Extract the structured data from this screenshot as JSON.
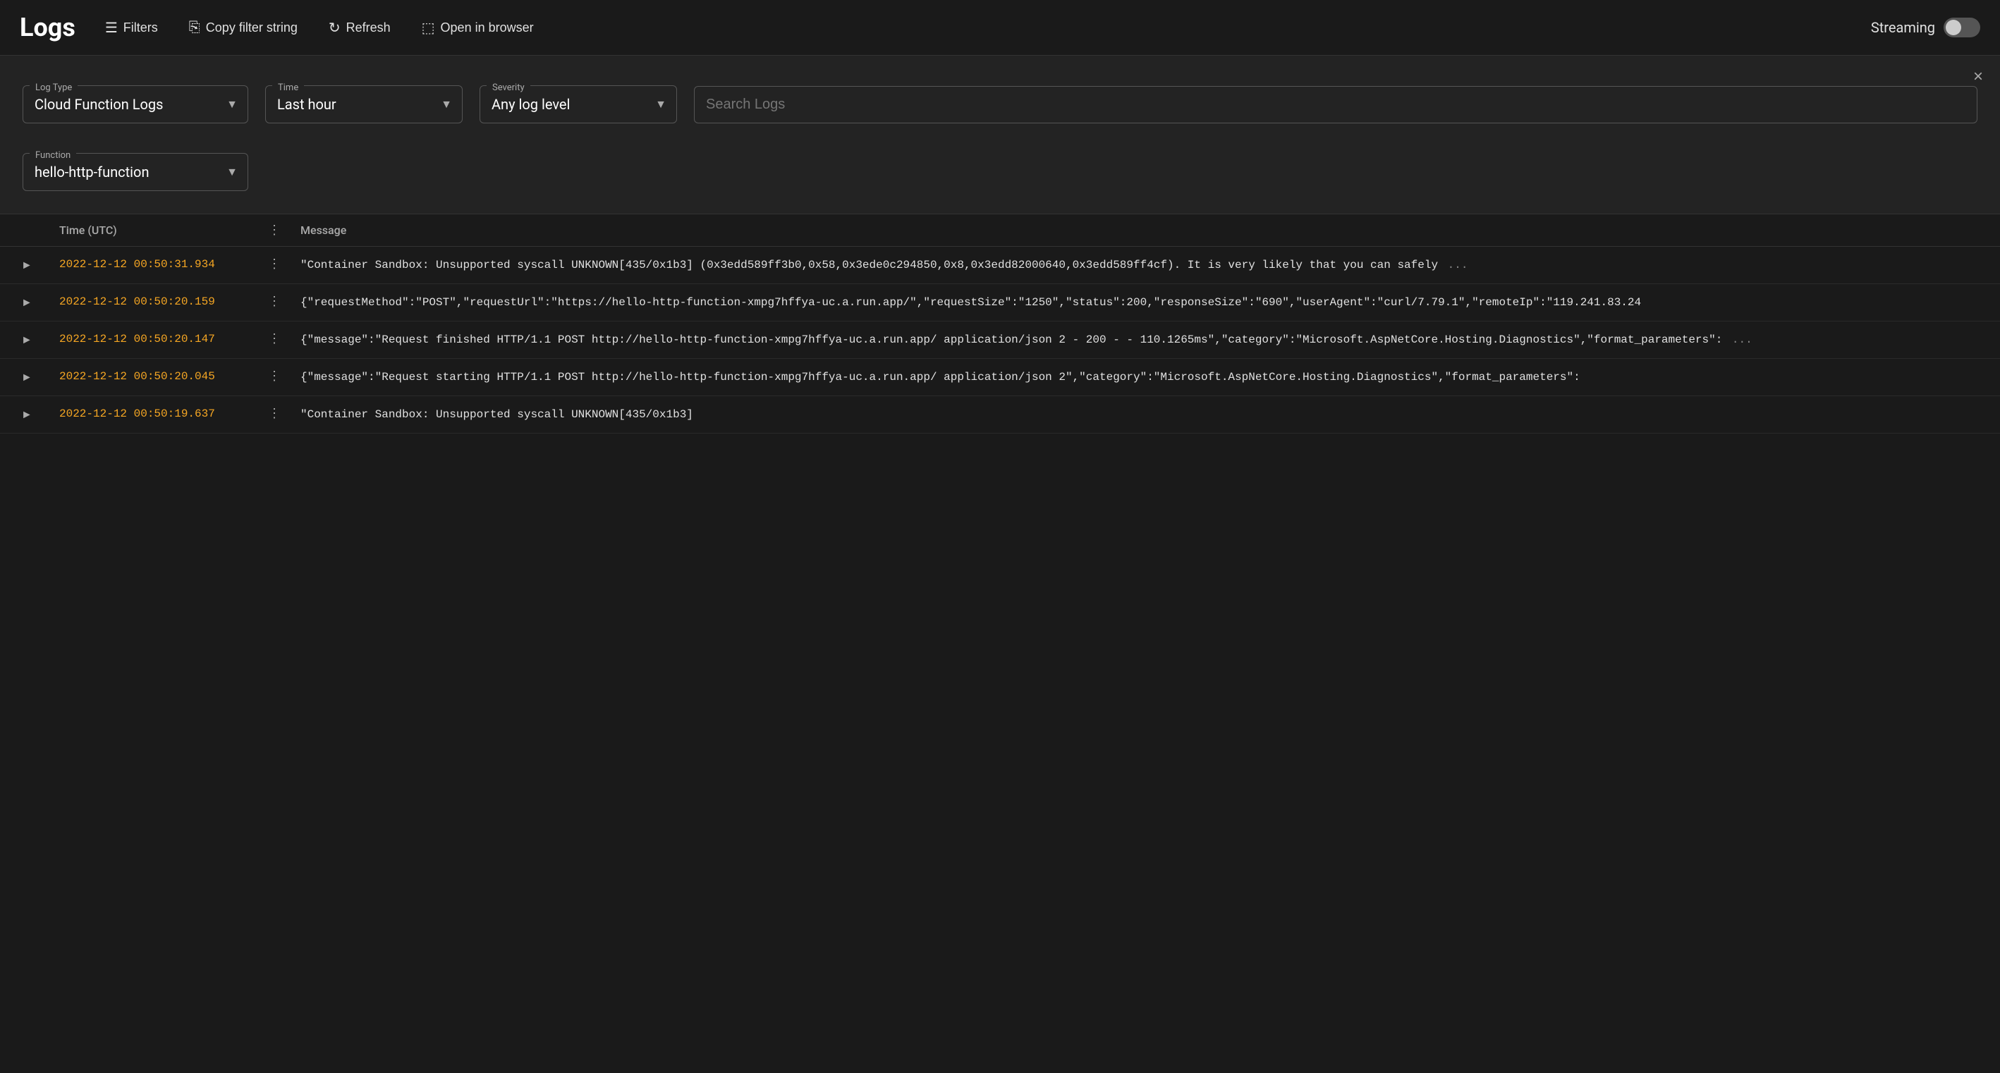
{
  "header": {
    "title": "Logs",
    "filters_label": "Filters",
    "copy_filter_label": "Copy filter string",
    "refresh_label": "Refresh",
    "open_browser_label": "Open in browser",
    "streaming_label": "Streaming",
    "streaming_enabled": false
  },
  "filters": {
    "close_label": "×",
    "log_type": {
      "label": "Log Type",
      "value": "Cloud Function Logs"
    },
    "time": {
      "label": "Time",
      "value": "Last hour"
    },
    "severity": {
      "label": "Severity",
      "value": "Any log level"
    },
    "search": {
      "placeholder": "Search Logs"
    },
    "function": {
      "label": "Function",
      "value": "hello-http-function"
    }
  },
  "table": {
    "columns": {
      "expand": "",
      "time": "Time (UTC)",
      "message": "Message"
    },
    "rows": [
      {
        "time": "2022-12-12 00:50:31.934",
        "message": "\"Container Sandbox: Unsupported syscall UNKNOWN[435/0x1b3] (0x3edd589ff3b0,0x58,0x3ede0c294850,0x8,0x3edd82000640,0x3edd589ff4cf). It is very likely that you can safely",
        "has_ellipsis": true
      },
      {
        "time": "2022-12-12 00:50:20.159",
        "message": "{\"requestMethod\":\"POST\",\"requestUrl\":\"https://hello-http-function-xmpg7hffya-uc.a.run.app/\",\"requestSize\":\"1250\",\"status\":200,\"responseSize\":\"690\",\"userAgent\":\"curl/7.79.1\",\"remoteIp\":\"119.241.83.24",
        "has_ellipsis": false
      },
      {
        "time": "2022-12-12 00:50:20.147",
        "message": "{\"message\":\"Request finished HTTP/1.1 POST http://hello-http-function-xmpg7hffya-uc.a.run.app/ application/json 2 - 200 - - 110.1265ms\",\"category\":\"Microsoft.AspNetCore.Hosting.Diagnostics\",\"format_parameters\":",
        "has_ellipsis": true
      },
      {
        "time": "2022-12-12 00:50:20.045",
        "message": "{\"message\":\"Request starting HTTP/1.1 POST http://hello-http-function-xmpg7hffya-uc.a.run.app/ application/json 2\",\"category\":\"Microsoft.AspNetCore.Hosting.Diagnostics\",\"format_parameters\":",
        "has_ellipsis": false
      },
      {
        "time": "2022-12-12 00:50:19.637",
        "message": "\"Container Sandbox: Unsupported syscall UNKNOWN[435/0x1b3]",
        "has_ellipsis": false
      }
    ]
  }
}
